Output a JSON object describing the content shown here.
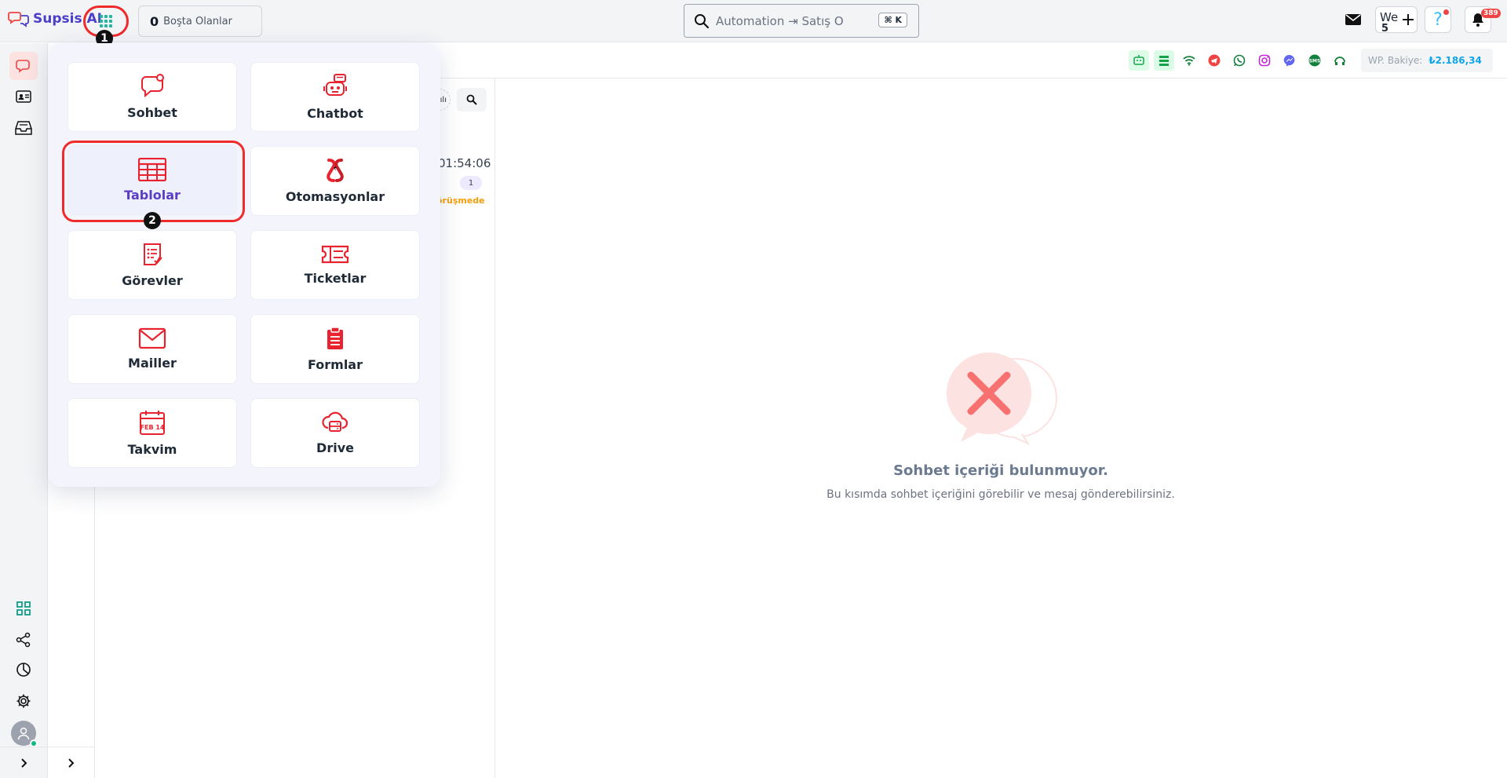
{
  "brand": {
    "name": "Supsis AI",
    "color": "#4c3fc7"
  },
  "annotations": {
    "step1": "1",
    "step2": "2"
  },
  "topbar": {
    "idle_count": "0",
    "idle_label": "Boşta Olanlar",
    "search_placeholder": "Automation ⇥ Satış O",
    "search_shortcut": "⌘ K",
    "we_label": "We",
    "we_count": "5",
    "help_label": "?",
    "notifications_count": "389"
  },
  "channels": {
    "icons": [
      "bot-icon",
      "list-icon",
      "wifi-icon",
      "telegram-icon",
      "whatsapp-icon",
      "instagram-icon",
      "messenger-icon",
      "sms-icon",
      "headset-icon"
    ],
    "balance_label": "WP. Bakiye:",
    "balance_value": "₺2.186,34"
  },
  "apps_menu": {
    "items": [
      {
        "label": "Sohbet",
        "icon": "chat-icon"
      },
      {
        "label": "Chatbot",
        "icon": "robot-icon"
      },
      {
        "label": "Tablolar",
        "icon": "table-icon"
      },
      {
        "label": "Otomasyonlar",
        "icon": "automation-icon"
      },
      {
        "label": "Görevler",
        "icon": "tasks-icon"
      },
      {
        "label": "Ticketlar",
        "icon": "ticket-icon"
      },
      {
        "label": "Mailler",
        "icon": "mail-icon"
      },
      {
        "label": "Formlar",
        "icon": "form-icon"
      },
      {
        "label": "Takvim",
        "icon": "calendar-icon",
        "calendar_text": "FEB 14"
      },
      {
        "label": "Drive",
        "icon": "drive-icon"
      }
    ],
    "selected": "Tablolar",
    "accent": "#e8232f"
  },
  "chat_list": {
    "time": "01:54:06",
    "unread": "1",
    "status": "örüşmede",
    "filter_partial": "ılı"
  },
  "empty_state": {
    "title": "Sohbet içeriği bulunmuyor.",
    "description": "Bu kısımda sohbet içeriğini görebilir ve mesaj gönderebilirsiniz."
  }
}
